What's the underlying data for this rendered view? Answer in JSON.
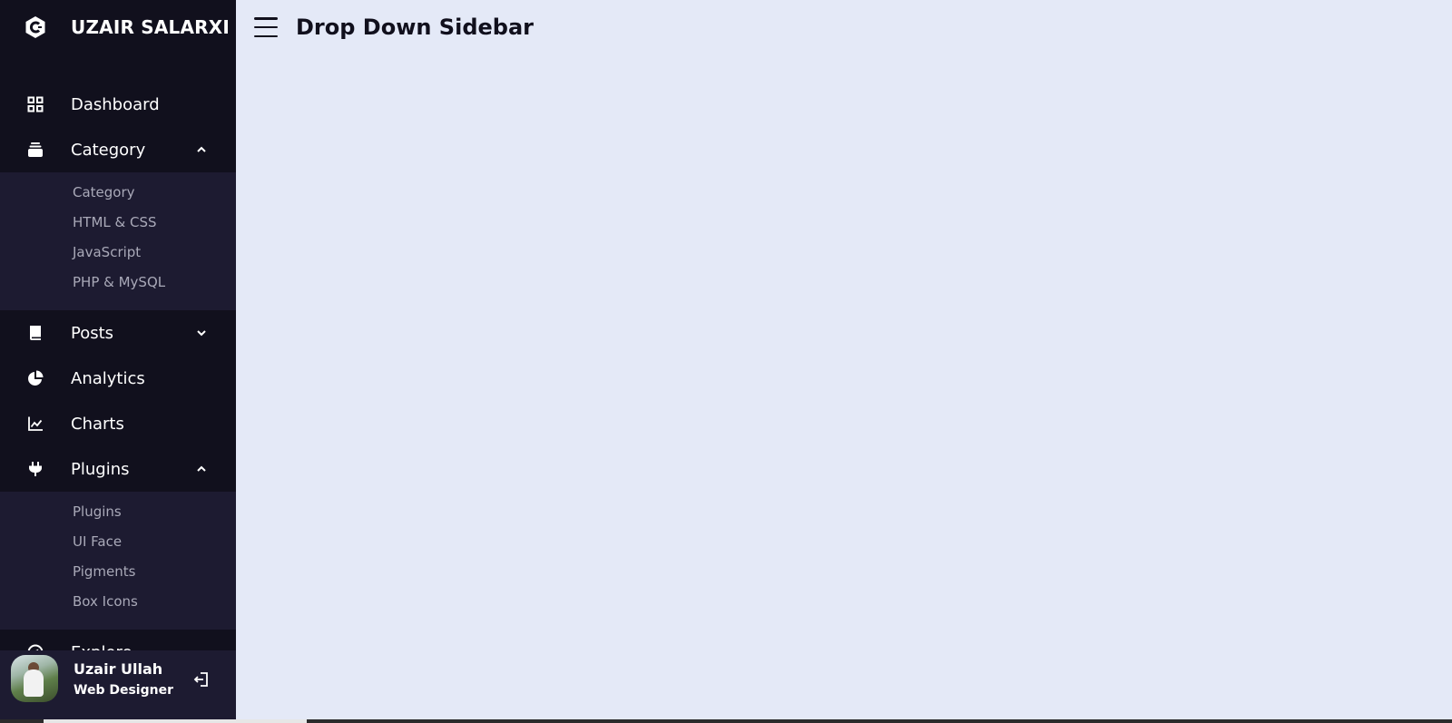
{
  "brand": {
    "name": "UZAIR SALARXI",
    "icon": "c-hexagon-logo-icon"
  },
  "sidebar": {
    "items": [
      {
        "label": "Dashboard",
        "icon": "grid-icon",
        "has_submenu": false
      },
      {
        "label": "Category",
        "icon": "collection-icon",
        "has_submenu": true,
        "expanded": true,
        "submenu": [
          "Category",
          "HTML & CSS",
          "JavaScript",
          "PHP & MySQL"
        ]
      },
      {
        "label": "Posts",
        "icon": "book-icon",
        "has_submenu": true,
        "expanded": false
      },
      {
        "label": "Analytics",
        "icon": "pie-chart-icon",
        "has_submenu": false
      },
      {
        "label": "Charts",
        "icon": "line-chart-icon",
        "has_submenu": false
      },
      {
        "label": "Plugins",
        "icon": "plug-icon",
        "has_submenu": true,
        "expanded": true,
        "submenu": [
          "Plugins",
          "UI Face",
          "Pigments",
          "Box Icons"
        ]
      },
      {
        "label": "Explore",
        "icon": "compass-icon",
        "has_submenu": false
      }
    ]
  },
  "profile": {
    "name": "Uzair Ullah",
    "job": "Web Designer",
    "logout_icon": "log-out-icon"
  },
  "header": {
    "menu_icon": "hamburger-menu-icon",
    "title": "Drop Down Sidebar"
  },
  "colors": {
    "sidebar": "#11101d",
    "submenu": "#1d1b31",
    "page": "#e4e9f7",
    "text": "#11101d"
  }
}
